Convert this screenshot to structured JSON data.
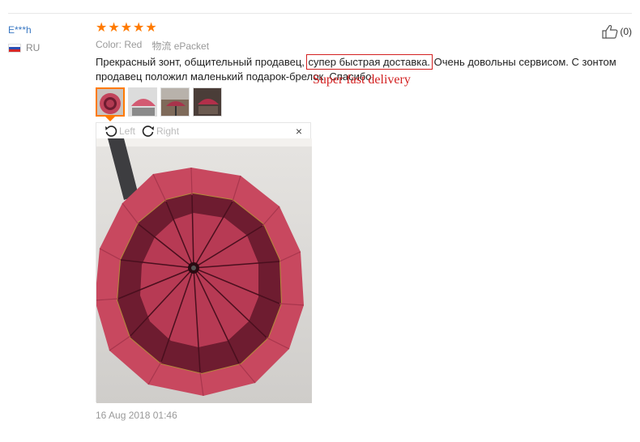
{
  "review": {
    "buyer_name": "E***h",
    "country_code": "RU",
    "rating": 5,
    "color_label": "Color: Red",
    "shipping_label": "物流 ePacket",
    "text_before": "Прекрасный зонт, общительный продавец, ",
    "text_highlight": "супер быстрая доставка.",
    "text_after": " Очень довольны сервисом. С зонтом продавец положил маленький подарок-брелок. Спасибо.",
    "annotation": "Super fast delivery",
    "helpful_count": "(0)",
    "date": "16 Aug 2018 01:46"
  },
  "viewer": {
    "rotate_left_label": "Left",
    "rotate_right_label": "Right",
    "close_label": "×"
  },
  "icons": {
    "star": "star-icon",
    "thumbs_up": "thumbs-up-icon",
    "rotate_left": "rotate-left-icon",
    "rotate_right": "rotate-right-icon",
    "close": "close-icon",
    "flag": "russia-flag-icon"
  },
  "colors": {
    "accent_orange": "#ff7a00",
    "link_blue": "#3a78c3",
    "annotation_red": "#d32020",
    "umbrella_pink": "#c2455c",
    "umbrella_dark": "#6e1c30"
  }
}
